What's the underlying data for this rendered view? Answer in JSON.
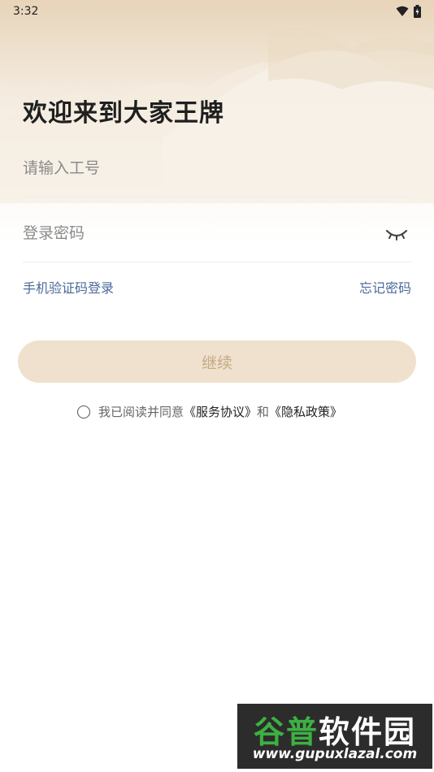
{
  "status_bar": {
    "time": "3:32",
    "wifi_icon": "wifi-icon",
    "battery_icon": "battery-charging-icon"
  },
  "page": {
    "title": "欢迎来到大家王牌"
  },
  "form": {
    "employee_id": {
      "placeholder": "请输入工号",
      "value": ""
    },
    "password": {
      "placeholder": "登录密码",
      "value": "",
      "toggle_icon": "eye-closed-icon"
    }
  },
  "links": {
    "sms_login": "手机验证码登录",
    "forgot_password": "忘记密码"
  },
  "actions": {
    "continue_label": "继续"
  },
  "agreement": {
    "checked": false,
    "prefix": "我已阅读并同意",
    "service_terms": "《服务协议》",
    "conjunction": "和",
    "privacy_policy": "《隐私政策》"
  },
  "watermark": {
    "brand_part1": "谷普",
    "brand_part2": "软件园",
    "url": "www.gupuxlazal.com"
  },
  "colors": {
    "accent_link": "#4a6a9a",
    "button_bg": "#efe1cd",
    "button_text": "#c5ab86",
    "header_tint": "#e7d4b9"
  }
}
